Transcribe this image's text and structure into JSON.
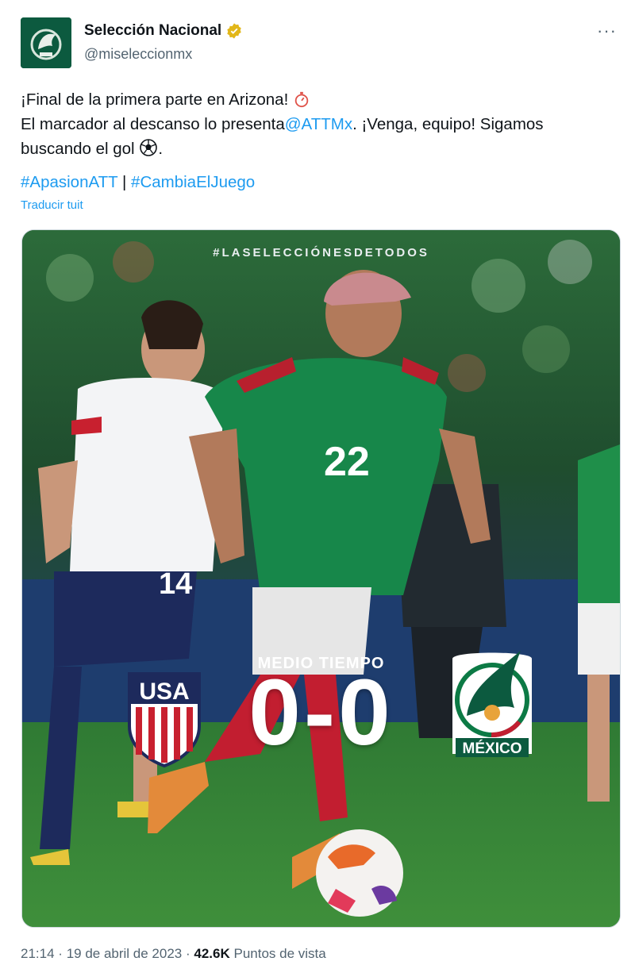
{
  "account": {
    "display_name": "Selección Nacional",
    "handle": "@miseleccionmx",
    "verified_icon": "gold-verified-badge",
    "more_label": "···"
  },
  "tweet": {
    "line1": "¡Final de la primera parte en Arizona!",
    "line2_before": "El marcador al descanso lo presenta",
    "line2_mention": "@ATTMx",
    "line2_after": ". ¡Venga, equipo! Sigamos",
    "line3": "buscando el gol",
    "line3_end": ".",
    "hashtag1": "#ApasionATT",
    "hashtag_separator": "|",
    "hashtag2": "#CambiaElJuego",
    "translate": "Traducir tuit"
  },
  "media": {
    "tagline": "#LASELECCIÓNESDETODOS",
    "half_label": "MEDIO TIEMPO",
    "score": "0-0",
    "home_crest_text": "USA",
    "away_crest_text": "MÉXICO",
    "player_number": "22",
    "opponent_number": "14"
  },
  "footer": {
    "time": "21:14",
    "separator": "·",
    "date": "19 de abril de 2023",
    "views_count": "42.6K",
    "views_label": "Puntos de vista"
  },
  "colors": {
    "link": "#1d9bf0",
    "text": "#0f1419",
    "secondary": "#536471",
    "mexico_green": "#0c5a3f"
  }
}
